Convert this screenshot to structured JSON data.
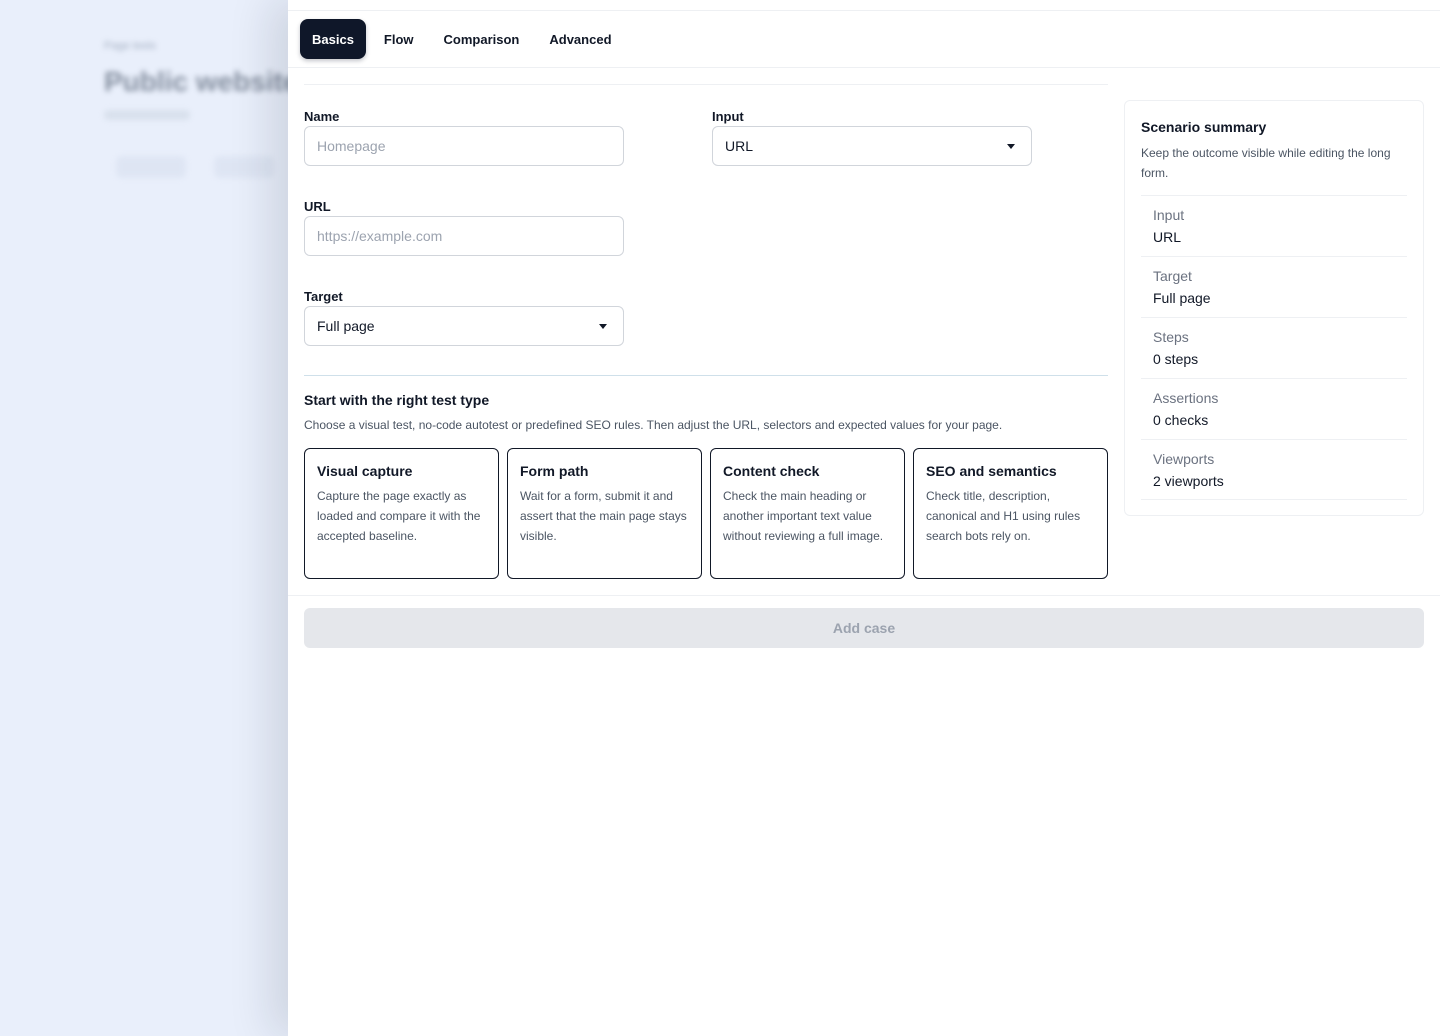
{
  "background_page": {
    "breadcrumb": "Page tests",
    "title": "Public website"
  },
  "tabs": [
    {
      "label": "Basics",
      "active": true
    },
    {
      "label": "Flow",
      "active": false
    },
    {
      "label": "Comparison",
      "active": false
    },
    {
      "label": "Advanced",
      "active": false
    }
  ],
  "form": {
    "name": {
      "label": "Name",
      "value": "",
      "placeholder": "Homepage"
    },
    "input": {
      "label": "Input",
      "value": "URL"
    },
    "url": {
      "label": "URL",
      "value": "",
      "placeholder": "https://example.com"
    },
    "target": {
      "label": "Target",
      "value": "Full page"
    }
  },
  "test_type": {
    "title": "Start with the right test type",
    "description": "Choose a visual test, no-code autotest or predefined SEO rules. Then adjust the URL, selectors and expected values for your page.",
    "cards": [
      {
        "title": "Visual capture",
        "description": "Capture the page exactly as loaded and compare it with the accepted baseline."
      },
      {
        "title": "Form path",
        "description": "Wait for a form, submit it and assert that the main page stays visible."
      },
      {
        "title": "Content check",
        "description": "Check the main heading or another important text value without reviewing a full image."
      },
      {
        "title": "SEO and semantics",
        "description": "Check title, description, canonical and H1 using rules search bots rely on."
      }
    ]
  },
  "summary": {
    "title": "Scenario summary",
    "description": "Keep the outcome visible while editing the long form.",
    "rows": [
      {
        "label": "Input",
        "value": "URL"
      },
      {
        "label": "Target",
        "value": "Full page"
      },
      {
        "label": "Steps",
        "value": "0 steps"
      },
      {
        "label": "Assertions",
        "value": "0 checks"
      },
      {
        "label": "Viewports",
        "value": "2 viewports"
      }
    ]
  },
  "footer": {
    "add_label": "Add case"
  }
}
